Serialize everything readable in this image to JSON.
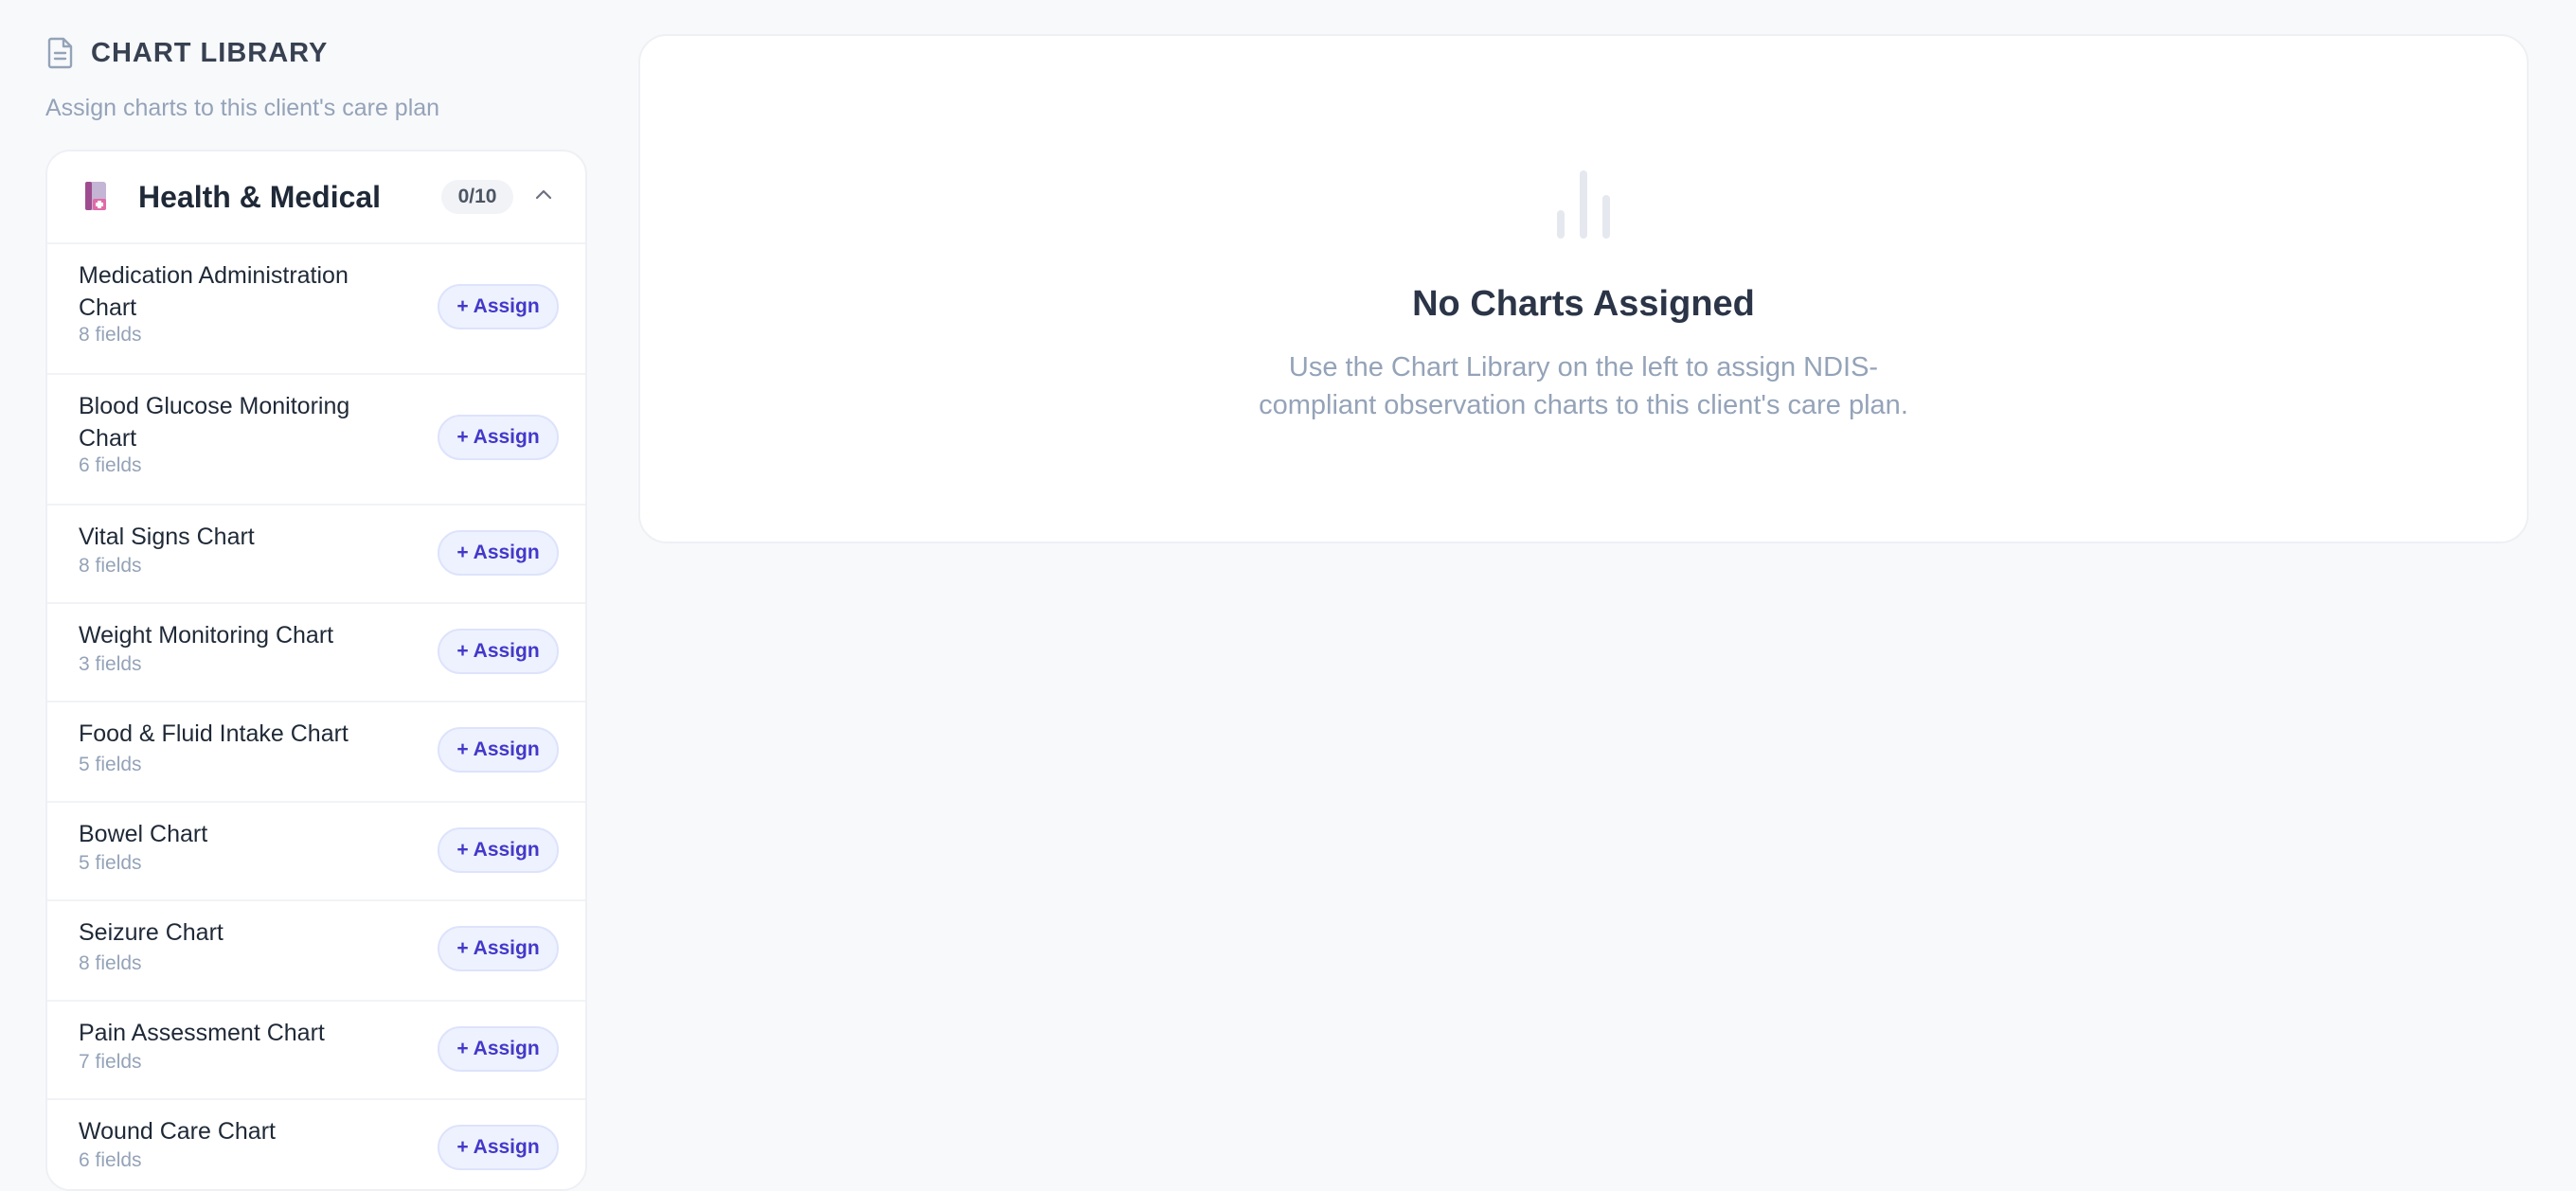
{
  "library": {
    "title": "CHART LIBRARY",
    "subtitle": "Assign charts to this client's care plan",
    "icon": "document-icon"
  },
  "category": {
    "icon": "medical-kit-icon",
    "title": "Health & Medical",
    "count": "0/10",
    "toggle_icon": "chevron-up-icon",
    "items": [
      {
        "name": "Medication Administration Chart",
        "fields": "8 fields",
        "action": "+ Assign"
      },
      {
        "name": "Blood Glucose Monitoring Chart",
        "fields": "6 fields",
        "action": "+ Assign"
      },
      {
        "name": "Vital Signs Chart",
        "fields": "8 fields",
        "action": "+ Assign"
      },
      {
        "name": "Weight Monitoring Chart",
        "fields": "3 fields",
        "action": "+ Assign"
      },
      {
        "name": "Food & Fluid Intake Chart",
        "fields": "5 fields",
        "action": "+ Assign"
      },
      {
        "name": "Bowel Chart",
        "fields": "5 fields",
        "action": "+ Assign"
      },
      {
        "name": "Seizure Chart",
        "fields": "8 fields",
        "action": "+ Assign"
      },
      {
        "name": "Pain Assessment Chart",
        "fields": "7 fields",
        "action": "+ Assign"
      },
      {
        "name": "Wound Care Chart",
        "fields": "6 fields",
        "action": "+ Assign"
      }
    ]
  },
  "empty_state": {
    "icon": "bar-chart-icon",
    "title": "No Charts Assigned",
    "line1": "Use the Chart Library on the left to assign NDIS-",
    "line2": "compliant observation charts to this client's care plan."
  }
}
